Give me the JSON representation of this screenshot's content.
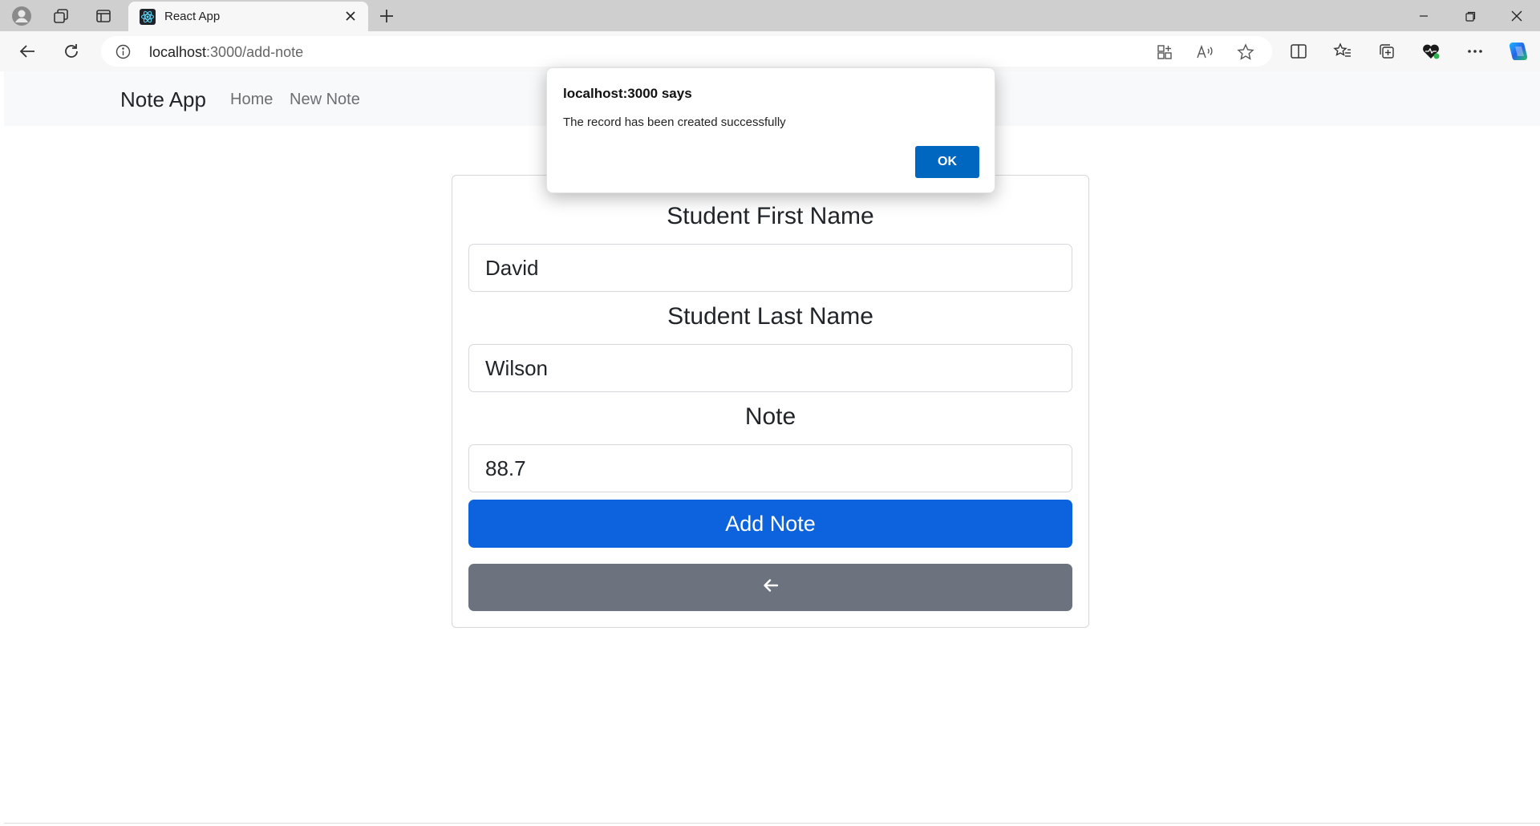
{
  "browser": {
    "tab": {
      "title": "React App"
    },
    "address_bar": {
      "host": "localhost",
      "path": ":3000/add-note"
    }
  },
  "navbar": {
    "brand": "Note App",
    "links": [
      "Home",
      "New Note"
    ]
  },
  "form": {
    "first_name": {
      "label": "Student First Name",
      "value": "David"
    },
    "last_name": {
      "label": "Student Last Name",
      "value": "Wilson"
    },
    "note": {
      "label": "Note",
      "value": "88.7"
    },
    "submit_label": "Add Note",
    "back_icon": "arrow-left-icon"
  },
  "dialog": {
    "title": "localhost:3000 says",
    "message": "The record has been created successfully",
    "ok_label": "OK"
  },
  "colors": {
    "primary": "#0d63de",
    "secondary": "#6c737e",
    "dialog_ok": "#0067c0"
  }
}
